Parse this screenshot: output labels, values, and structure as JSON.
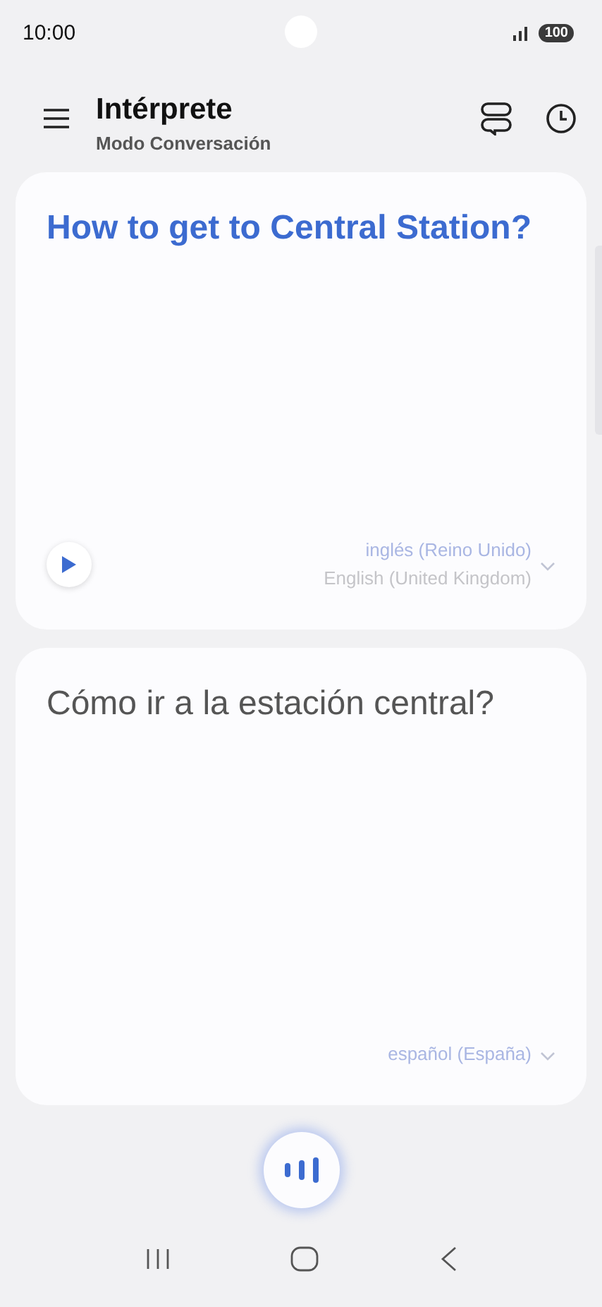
{
  "status_bar": {
    "time": "10:00",
    "battery": "100"
  },
  "header": {
    "title": "Intérprete",
    "subtitle": "Modo Conversación"
  },
  "cards": [
    {
      "kind": "source",
      "text": "How to get to Central Station?",
      "language": "inglés (Reino Unido)",
      "language_native": "English (United Kingdom)"
    },
    {
      "kind": "target",
      "text": "Cómo ir a la estación central?",
      "language": "español (España)"
    }
  ]
}
